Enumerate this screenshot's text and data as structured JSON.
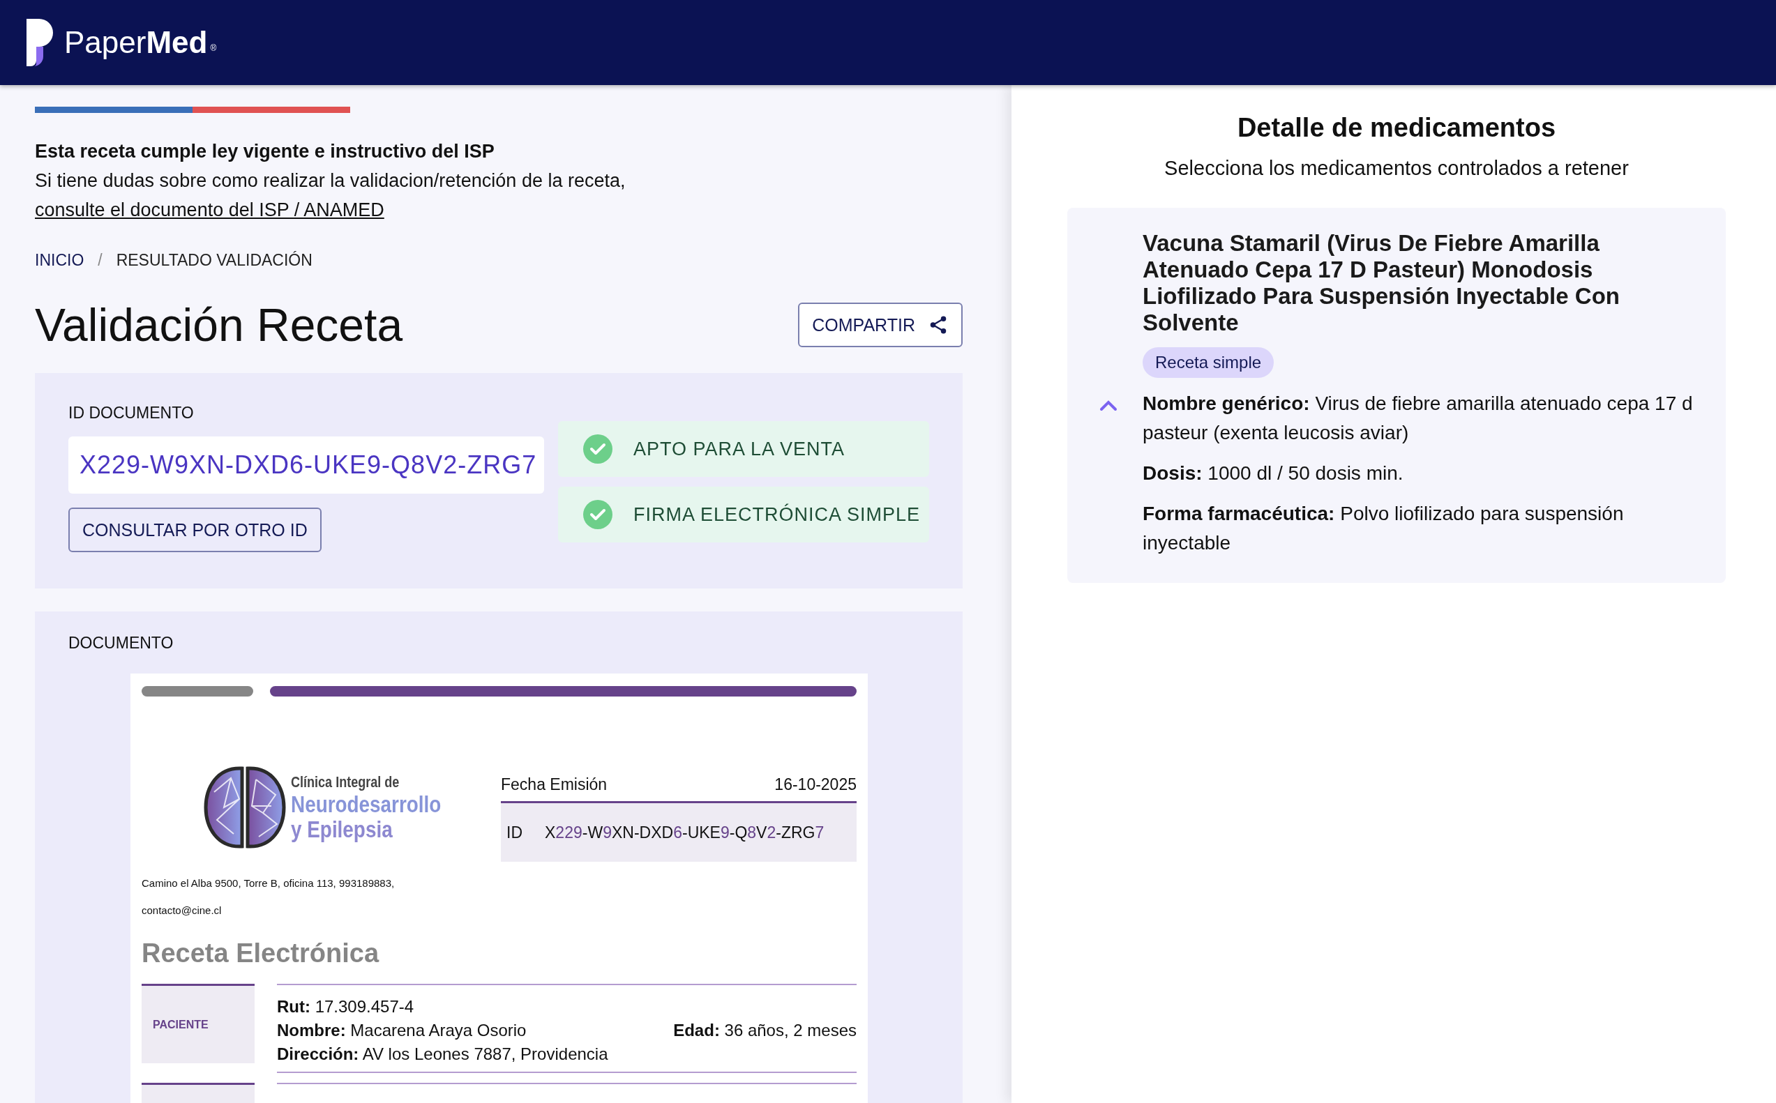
{
  "brand": {
    "name_light": "Paper",
    "name_bold": "Med",
    "mark": "®"
  },
  "notice": {
    "title": "Esta receta cumple ley vigente e instructivo del ISP",
    "text": "Si tiene dudas sobre como realizar la validacion/retención de la receta,",
    "link": "consulte el documento del ISP / ANAMED"
  },
  "breadcrumb": {
    "separator": "/",
    "items": [
      {
        "label": "INICIO",
        "current": false
      },
      {
        "label": "RESULTADO VALIDACIÓN",
        "current": true
      }
    ]
  },
  "page_title": "Validación Receta",
  "share_button": "COMPARTIR",
  "id_panel": {
    "label": "ID DOCUMENTO",
    "value": "X229-W9XN-DXD6-UKE9-Q8V2-ZRG7",
    "button": "CONSULTAR POR OTRO ID",
    "statuses": [
      {
        "label": "APTO PARA LA VENTA",
        "ok": true
      },
      {
        "label": "FIRMA ELECTRÓNICA SIMPLE",
        "ok": true
      }
    ]
  },
  "document": {
    "label": "DOCUMENTO",
    "clinic": {
      "line1": "Clínica Integral de",
      "line2": "Neurodesarrollo",
      "line3": "y Epilepsia"
    },
    "issue_date_label": "Fecha Emisión",
    "issue_date": "16-10-2025",
    "id_label": "ID",
    "id_value": "X229-W9XN-DXD6-UKE9-Q8V2-ZRG7",
    "address": "Camino el Alba 9500, Torre B, oficina 113, 993189883,",
    "email": "contacto@cine.cl",
    "heading": "Receta Electrónica",
    "patient": {
      "label": "PACIENTE",
      "rows": [
        [
          "**Rut:** 17.309.457-4"
        ],
        [
          "**Nombre:** Macarena Araya Osorio",
          "**Edad:** 36 años, 2 meses"
        ],
        [
          "**Dirección:** AV los Leones 7887, Providencia"
        ]
      ]
    }
  },
  "detail": {
    "title": "Detalle de medicamentos",
    "subtitle": "Selecciona los medicamentos controlados a retener",
    "medications": [
      {
        "name": "Vacuna Stamaril (Virus De Fiebre Amarilla Atenuado Cepa 17 D Pasteur) Monodosis Liofilizado Para Suspensión Inyectable Con Solvente",
        "badge": "Receta simple",
        "expanded": true,
        "fields": [
          "**Nombre genérico:** Virus de fiebre amarilla atenuado cepa 17 d pasteur (exenta leucosis aviar)",
          "**Dosis:** 1000 dl / 50 dosis min.",
          "**Forma farmacéutica:** Polvo liofilizado para suspensión inyectable"
        ]
      }
    ]
  }
}
